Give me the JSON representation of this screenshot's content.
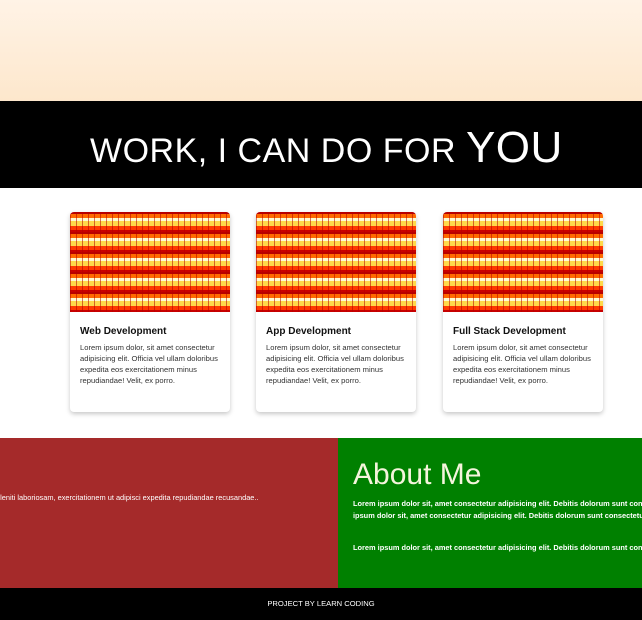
{
  "banner": {
    "title": "WORK, I CAN DO FOR ",
    "title_emphasis": "YOU"
  },
  "services": [
    {
      "title": "Web Development",
      "text": "Lorem ipsum dolor, sit amet consectetur adipisicing elit. Officia vel ullam doloribus expedita eos exercitationem minus repudiandae! Velit, ex porro."
    },
    {
      "title": "App Development",
      "text": "Lorem ipsum dolor, sit amet consectetur adipisicing elit. Officia vel ullam doloribus expedita eos exercitationem minus repudiandae! Velit, ex porro."
    },
    {
      "title": "Full Stack Development",
      "text": "Lorem ipsum dolor, sit amet consectetur adipisicing elit. Officia vel ullam doloribus expedita eos exercitationem minus repudiandae! Velit, ex porro."
    }
  ],
  "about": {
    "left_text": "eleniti laboriosam, exercitationem ut adipisci expedita repudiandae recusandae..",
    "heading": "About Me",
    "paragraph1": "Lorem ipsum dolor sit, amet consectetur adipisicing elit. Debitis dolorum sunt consectetur ipsum dolor sit, amet consectetur adipisicing elit. Debitis dolorum sunt consectetur",
    "paragraph2": "Lorem ipsum dolor sit, amet consectetur adipisicing elit. Debitis dolorum sunt consectetur"
  },
  "footer": {
    "text": "PROJECT BY LEARN CODING"
  },
  "colors": {
    "banner_bg": "#000000",
    "about_left_bg": "#a52a2a",
    "about_right_bg": "#008000",
    "hero_bg": "#fde7cc"
  }
}
